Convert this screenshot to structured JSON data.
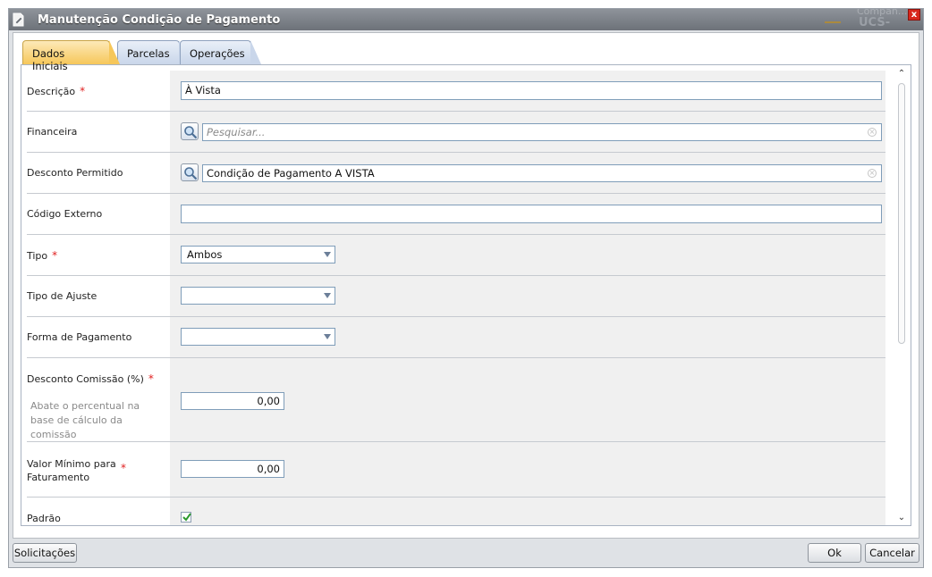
{
  "window": {
    "title": "Manutenção Condição de Pagamento",
    "background_company": "Compan...",
    "background_unit": "UCS-Caxias",
    "close_label": "x"
  },
  "tabs": [
    {
      "label": "Dados Iniciais",
      "active": true
    },
    {
      "label": "Parcelas",
      "active": false
    },
    {
      "label": "Operações",
      "active": false
    }
  ],
  "form": {
    "descricao": {
      "label": "Descrição",
      "required": "*",
      "value": "À Vista"
    },
    "financeira": {
      "label": "Financeira",
      "placeholder": "Pesquisar..."
    },
    "desconto_permitido": {
      "label": "Desconto Permitido",
      "value": "Condição de Pagamento A VISTA"
    },
    "codigo_externo": {
      "label": "Código Externo",
      "value": ""
    },
    "tipo": {
      "label": "Tipo",
      "required": "*",
      "value": "Ambos"
    },
    "tipo_ajuste": {
      "label": "Tipo de Ajuste",
      "value": ""
    },
    "forma_pagamento": {
      "label": "Forma de Pagamento",
      "value": ""
    },
    "desconto_comissao": {
      "label": "Desconto Comissão (%)",
      "required": "*",
      "hint": "Abate o percentual na base de cálculo da comissão",
      "value": "0,00"
    },
    "valor_minimo": {
      "label": "Valor Mínimo para Faturamento",
      "required": "*",
      "value": "0,00"
    },
    "padrao": {
      "label": "Padrão",
      "checked": true
    }
  },
  "footer": {
    "solicitacoes_label": "Solicitações",
    "ok_label": "Ok",
    "cancelar_label": "Cancelar"
  },
  "colors": {
    "active_tab": "#f6c75a",
    "required": "#e02020",
    "input_border": "#7f9db9"
  }
}
